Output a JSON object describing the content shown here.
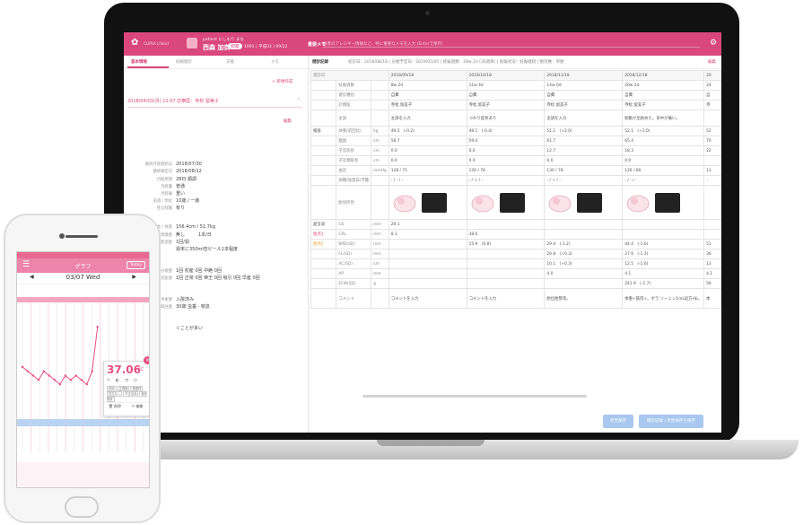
{
  "app": {
    "name": "CLIPLA (clinic)",
    "patient_name_small": "patient にしもり まな",
    "patient_name": "西森 加奈",
    "patient_badge": "初産",
    "patient_info": "1991 ( 平成03 ) 09/22",
    "memo_label": "重要メモ",
    "memo_placeholder": "患者のアレルギー情報など、特に重要なメモを入力 (Enterで保存)"
  },
  "left_tabs": [
    "基本情報",
    "妊婦健診",
    "支援",
    "メモ"
  ],
  "left": {
    "add_record": "+ 新規作成",
    "entry": "2018/04/03(月) 12:07 診察医：寺松 留美子",
    "edit": "編集",
    "rows": [
      {
        "k": "最終月経開始日",
        "v": "2018/07/30"
      },
      {
        "k": "最終確定日",
        "v": "2018/08/12"
      },
      {
        "k": "月経周期",
        "v": "28日 順調"
      },
      {
        "k": "月経量",
        "v": "普通"
      },
      {
        "k": "月経痛",
        "v": "重い"
      },
      {
        "k": "前週 / 現症",
        "v": "10歳 / 一歳"
      },
      {
        "k": "性交経験",
        "v": "有り"
      },
      {
        "k": "身長 / 体重",
        "v": "156.4cm / 51.7kg"
      },
      {
        "k": "喫煙歴",
        "v": "無し　　　1本/日"
      },
      {
        "k": "飲酒歴",
        "v": "1回/週"
      },
      {
        "k": "",
        "v": "週末に350ml缶ビール1本程度"
      },
      {
        "k": "分娩歴",
        "v": "1回 初産 0回 中絶 0回"
      },
      {
        "k": "流産歴",
        "v": "1回 正常 0回 帝王 0回 吸引 0回 早産 0回"
      },
      {
        "k": "手術歴",
        "v": "入院済み"
      },
      {
        "k": "既往歴",
        "v": "30歳 虫垂 - 喘息"
      },
      {
        "k": "",
        "v": "くことが多い"
      }
    ]
  },
  "main": {
    "title": "健診記録",
    "info": "初診日：2018/08/18 | 分娩予定日：2019/05/05 | 妊娠週数：28w 2d (36週目) | 妊娠状況：妊娠継続 | 胎児数：単胎",
    "edit": "編集",
    "date_header": [
      "受診日",
      "2018/09/18",
      "2018/10/18",
      "2018/11/18",
      "2018/12/18",
      "20"
    ],
    "rows": [
      [
        "妊娠週数",
        "",
        "8w 2d",
        "11w 4d",
        "14w 0d",
        "20w 2d",
        "24"
      ],
      [
        "健診種別",
        "",
        "自費",
        "自費",
        "自費",
        "自費",
        "自"
      ],
      [
        "診察医",
        "",
        "寺松 留美子",
        "寺松 留美子",
        "寺松 留美子",
        "寺松 留美子",
        "寺"
      ],
      [
        "主訴",
        "",
        "主訴を入力",
        "つわり症状あり",
        "主訴を入力",
        "胎動が出始めた。背中が痛い。",
        ""
      ],
      [
        "体重(前回比)",
        "kg",
        "49.5　(-0.2)",
        "49.1　(-0.4)",
        "51.1　(+2.0)",
        "52.1　(+1.0)",
        "52"
      ],
      [
        "腹囲",
        "cm",
        "58.7",
        "59.4",
        "61.7",
        "65.4",
        "70"
      ],
      [
        "子宮底長",
        "cm",
        "0.0",
        "0.0",
        "12.7",
        "18.3",
        "22"
      ],
      [
        "子宮頚管長",
        "cm",
        "0.0",
        "0.0",
        "0.0",
        "0.0",
        ""
      ],
      [
        "血圧",
        "mmHg",
        "128 / 71",
        "130 / 78",
        "130 / 78",
        "126 / 80",
        "13"
      ],
      [
        "尿糖/尿蛋白/浮腫",
        "",
        "- / - / -",
        "- / + / -",
        "- / + / -",
        "- / - / -",
        "-"
      ],
      [
        "GS",
        "mm",
        "29.1",
        "",
        "",
        "",
        ""
      ],
      [
        "CRL",
        "mm",
        "8.1",
        "38.6",
        "",
        "",
        ""
      ],
      [
        "BPD(SD)",
        "mm",
        "",
        "15.9　(0.8)",
        "29.4　(-1.2)",
        "44.4　(-1.6)",
        "51"
      ],
      [
        "FL(SD)",
        "mm",
        "",
        "",
        "20.8　(+0.3)",
        "27.6　(-1.3)",
        "36"
      ],
      [
        "AC(SD)",
        "cm",
        "",
        "",
        "10.1　(+0.3)",
        "12.5　(-1.6)",
        "13"
      ],
      [
        "AP",
        "mm",
        "",
        "",
        "4.0",
        "4.1",
        "4.1"
      ],
      [
        "EFW(SD)",
        "g",
        "",
        "",
        "",
        "241.9　(-1.7)",
        "56"
      ],
      [
        "コメント",
        "",
        "コメントを入力",
        "コメントを入力",
        "胎位胎勢等。",
        "体重+筋肉+。ボラ リーミン1mL処方Hb。",
        "体"
      ]
    ],
    "group_exam": "検査",
    "group_us": "超音波",
    "fetus1": "胎児1",
    "fetus2": "胎児2",
    "us_label": "胎児所見",
    "btn_save": "所見保存",
    "btn_save_all": "健診記録 / 所見保存を保存"
  },
  "phone": {
    "title": "グラフ",
    "today": "Today",
    "date": "03/07 Wed",
    "temp": "37.06",
    "temp_unit": "°C",
    "tags": [
      "排卵",
      "生理痛",
      "基礎体",
      "性交なし",
      "不正出血",
      "食欲異常"
    ],
    "btn_delete": "削除",
    "btn_edit": "編集"
  },
  "chart_data": {
    "type": "line",
    "title": "",
    "series": [
      {
        "values": [
          36.6,
          36.55,
          36.5,
          36.45,
          36.55,
          36.5,
          36.45,
          36.4,
          36.5,
          36.45,
          36.5,
          36.45,
          36.4,
          36.55,
          37.06
        ]
      }
    ],
    "ylim": [
      36.0,
      37.3
    ]
  },
  "colors": {
    "brand": "#d9477c",
    "accent_light": "#ec85a9",
    "button_disabled": "#a8c8ef"
  }
}
